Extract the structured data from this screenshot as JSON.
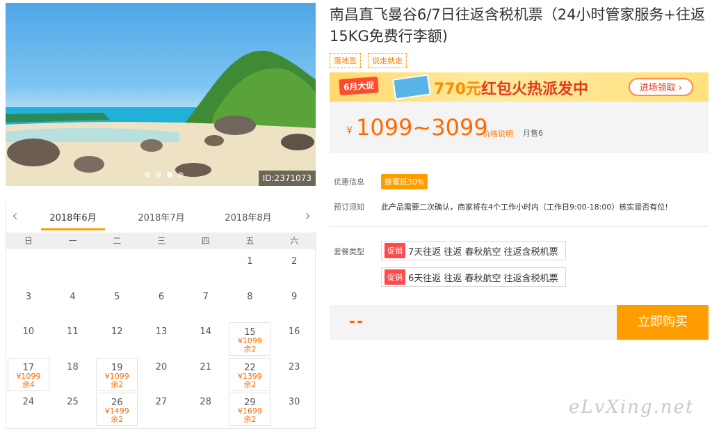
{
  "hero": {
    "id_label": "ID:2371073",
    "dots": 4,
    "active_dot": 2
  },
  "calendar": {
    "tabs": [
      {
        "label": "2018年6月",
        "active": true
      },
      {
        "label": "2018年7月",
        "active": false
      },
      {
        "label": "2018年8月",
        "active": false
      }
    ],
    "weekdays": [
      "日",
      "一",
      "二",
      "三",
      "四",
      "五",
      "六"
    ],
    "days": [
      {
        "d": "1",
        "row": 0,
        "col": 5
      },
      {
        "d": "2",
        "row": 0,
        "col": 6
      },
      {
        "d": "3",
        "row": 1,
        "col": 0
      },
      {
        "d": "4",
        "row": 1,
        "col": 1
      },
      {
        "d": "5",
        "row": 1,
        "col": 2
      },
      {
        "d": "6",
        "row": 1,
        "col": 3
      },
      {
        "d": "7",
        "row": 1,
        "col": 4
      },
      {
        "d": "8",
        "row": 1,
        "col": 5
      },
      {
        "d": "9",
        "row": 1,
        "col": 6
      },
      {
        "d": "10",
        "row": 2,
        "col": 0
      },
      {
        "d": "11",
        "row": 2,
        "col": 1
      },
      {
        "d": "12",
        "row": 2,
        "col": 2
      },
      {
        "d": "13",
        "row": 2,
        "col": 3
      },
      {
        "d": "14",
        "row": 2,
        "col": 4
      },
      {
        "d": "15",
        "row": 2,
        "col": 5,
        "price": "¥1099",
        "left": "余2"
      },
      {
        "d": "16",
        "row": 2,
        "col": 6
      },
      {
        "d": "17",
        "row": 3,
        "col": 0,
        "price": "¥1099",
        "left": "余4"
      },
      {
        "d": "18",
        "row": 3,
        "col": 1
      },
      {
        "d": "19",
        "row": 3,
        "col": 2,
        "price": "¥1099",
        "left": "余2"
      },
      {
        "d": "20",
        "row": 3,
        "col": 3
      },
      {
        "d": "21",
        "row": 3,
        "col": 4
      },
      {
        "d": "22",
        "row": 3,
        "col": 5,
        "price": "¥1399",
        "left": "余2"
      },
      {
        "d": "23",
        "row": 3,
        "col": 6
      },
      {
        "d": "24",
        "row": 4,
        "col": 0
      },
      {
        "d": "25",
        "row": 4,
        "col": 1
      },
      {
        "d": "26",
        "row": 4,
        "col": 2,
        "price": "¥1499",
        "left": "余2"
      },
      {
        "d": "27",
        "row": 4,
        "col": 3
      },
      {
        "d": "28",
        "row": 4,
        "col": 4
      },
      {
        "d": "29",
        "row": 4,
        "col": 5,
        "price": "¥1699",
        "left": "余2"
      },
      {
        "d": "30",
        "row": 4,
        "col": 6
      }
    ]
  },
  "product": {
    "title": "南昌直飞曼谷6/7日往返含税机票（24小时管家服务+往返15KG免费行李额)",
    "tags": [
      "落地签",
      "说走就走"
    ]
  },
  "banner": {
    "badge": "6月大促",
    "amount": "770元",
    "text": "红包火热派发中",
    "button": "进场领取 ›"
  },
  "price": {
    "currency": "¥",
    "range": "1099~3099",
    "note": "价格说明",
    "sold": "月售6"
  },
  "info": {
    "promo_label": "优惠信息",
    "promo_badge": "蜂蜜抵30%",
    "notice_label": "预订须知",
    "notice_text": "此产品需要二次确认，商家将在4个工作小时内（工作日9:00-18:00）核实是否有位!",
    "package_label": "套餐类型",
    "packages": [
      {
        "tag": "促销",
        "name": "7天往返 往返 春秋航空 往返含税机票"
      },
      {
        "tag": "促销",
        "name": "6天往返 往返 春秋航空 往返含税机票"
      }
    ]
  },
  "buy": {
    "placeholder": "--",
    "button": "立即购买"
  },
  "watermark": "eLvXing.net",
  "colors": {
    "accent": "#ff9d00",
    "price": "#ff6a00",
    "promo_red": "#ff4a4a"
  }
}
